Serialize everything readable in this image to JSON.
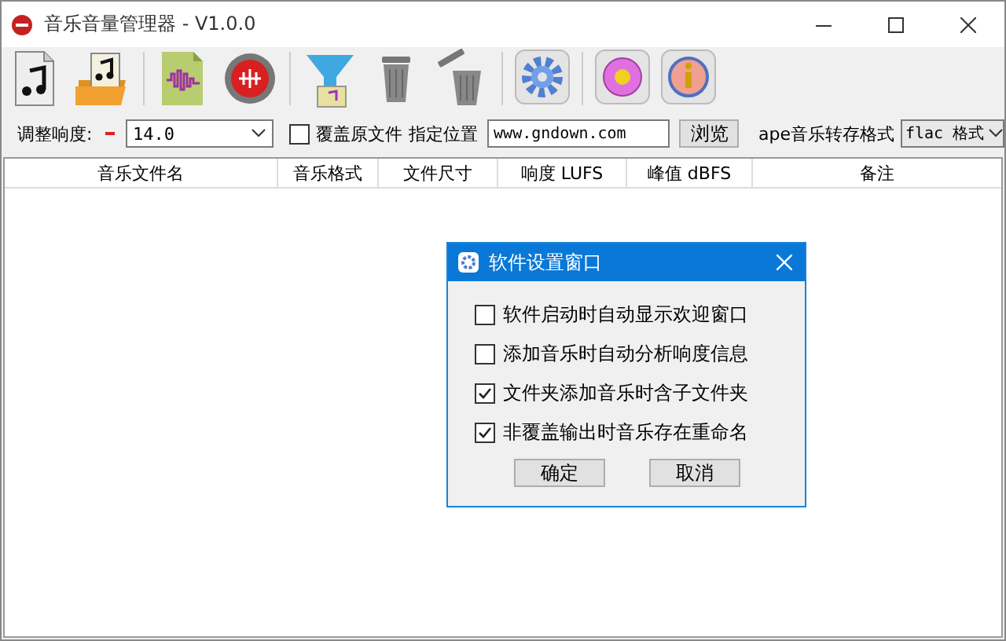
{
  "window": {
    "title": "音乐音量管理器 - V1.0.0"
  },
  "toolbar_groups": [
    {
      "buttons": [
        {
          "kind": "music-file"
        },
        {
          "kind": "music-folder"
        }
      ]
    },
    {
      "buttons": [
        {
          "kind": "wave-file"
        },
        {
          "kind": "record"
        }
      ]
    },
    {
      "buttons": [
        {
          "kind": "funnel"
        },
        {
          "kind": "trash"
        },
        {
          "kind": "trash-tilted"
        }
      ]
    },
    {
      "buttons": [
        {
          "kind": "gear"
        }
      ]
    },
    {
      "buttons": [
        {
          "kind": "help"
        },
        {
          "kind": "info"
        }
      ]
    }
  ],
  "options": {
    "loudness_label": "调整响度:",
    "loudness_value": "14.0",
    "overwrite": {
      "label": "覆盖原文件",
      "checked": false
    },
    "location_label": "指定位置",
    "location_value": "www.gndown.com",
    "browse_button": "浏览",
    "ape_label": "ape音乐转存格式",
    "ape_format": "flac 格式"
  },
  "table": {
    "columns": [
      "音乐文件名",
      "音乐格式",
      "文件尺寸",
      "响度 LUFS",
      "峰值 dBFS",
      "备注"
    ]
  },
  "dialog": {
    "title": "软件设置窗口",
    "options": [
      {
        "label": "软件启动时自动显示欢迎窗口",
        "checked": false
      },
      {
        "label": "添加音乐时自动分析响度信息",
        "checked": false
      },
      {
        "label": "文件夹添加音乐时含子文件夹",
        "checked": true
      },
      {
        "label": "非覆盖输出时音乐存在重命名",
        "checked": true
      }
    ],
    "buttons": [
      "确定",
      "取消"
    ]
  }
}
